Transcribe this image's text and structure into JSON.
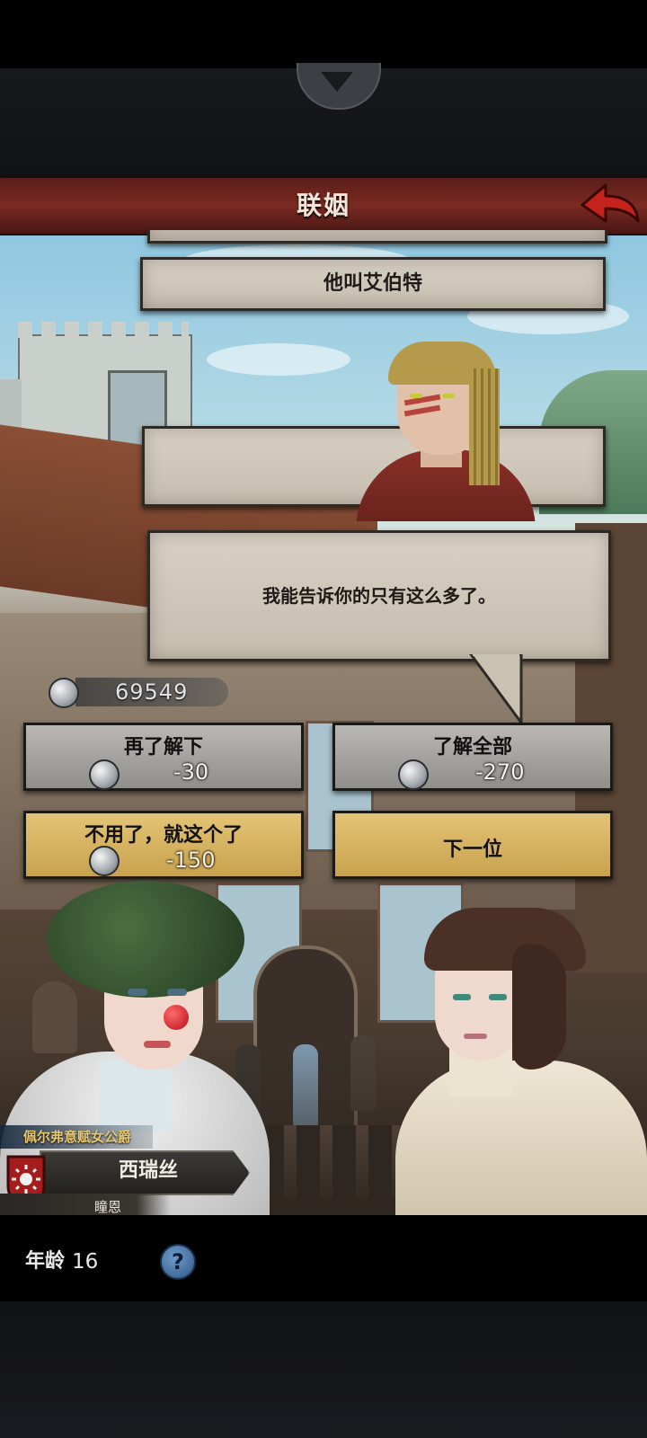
{
  "screen_title": "联姻",
  "suitor_name_box": "他叫艾伯特",
  "dialogue": "我能告诉你的只有这么多了。",
  "silver_balance": "69549",
  "options": [
    {
      "label": "再了解下",
      "cost": "-30",
      "style": "grey"
    },
    {
      "label": "了解全部",
      "cost": "-270",
      "style": "grey"
    },
    {
      "label": "不用了，就这个了",
      "cost": "-150",
      "style": "gold"
    },
    {
      "label": "下一位",
      "cost": "",
      "style": "gold"
    }
  ],
  "character": {
    "title": "佩尔弗意赋女公爵",
    "name": "西瑞丝",
    "house": "瞳恩",
    "age_label": "年龄",
    "age_value": "16"
  },
  "icons": {
    "back": "back-arrow-icon",
    "help": "question-mark-icon",
    "coin": "silver-coin-icon",
    "crest": "sun-crest-icon"
  },
  "colors": {
    "title_bar": "#6e241e",
    "gold_button": "#d6b25f",
    "grey_button": "#a3a29e",
    "help_icon": "#4a78a8"
  }
}
